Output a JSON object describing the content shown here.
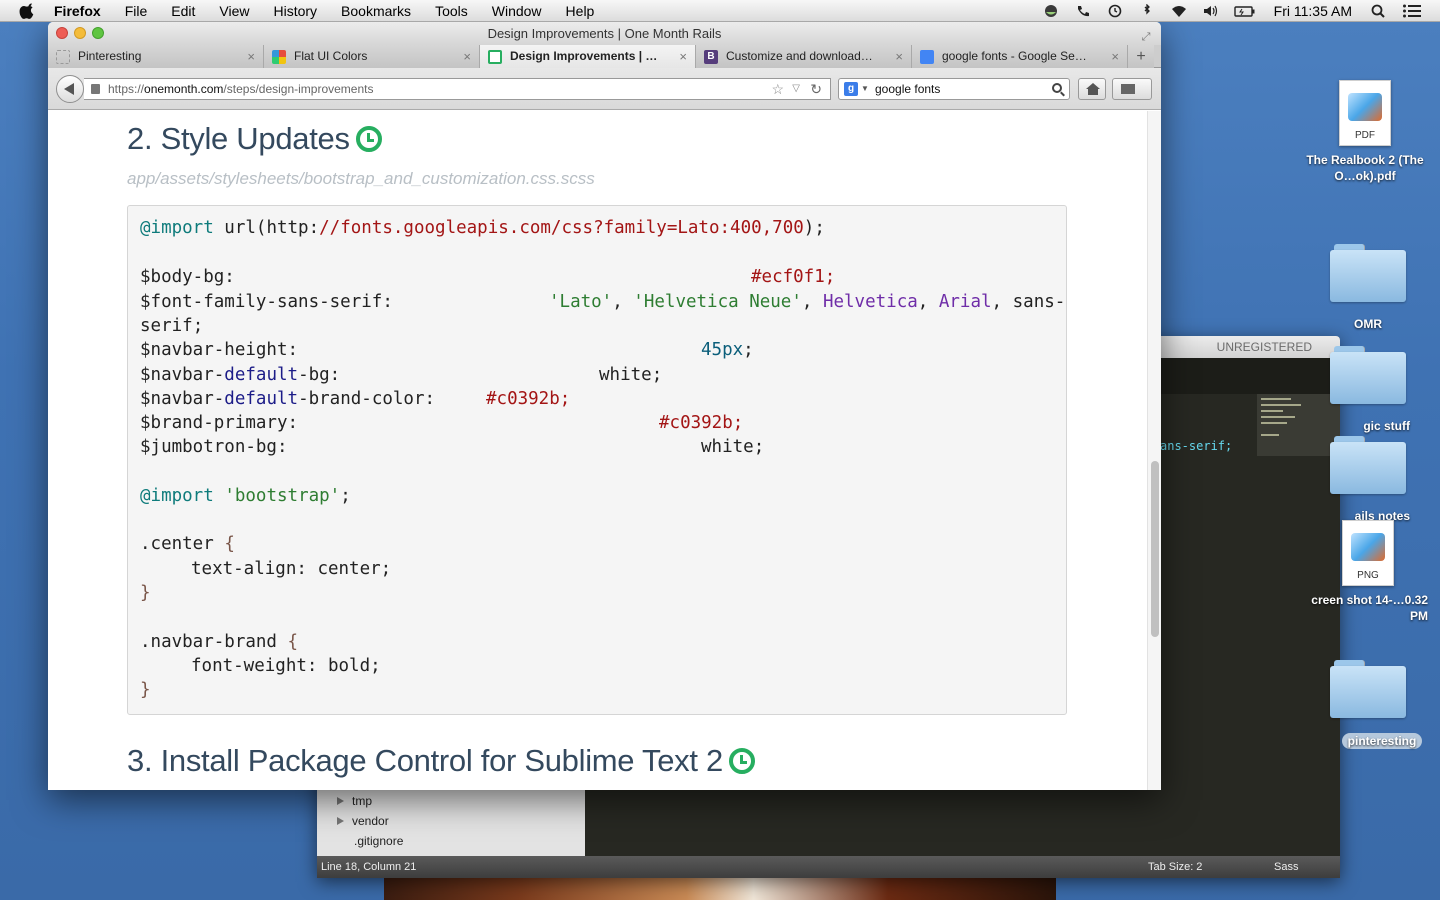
{
  "menubar": {
    "items": [
      "Firefox",
      "File",
      "Edit",
      "View",
      "History",
      "Bookmarks",
      "Tools",
      "Window",
      "Help"
    ],
    "clock": "Fri 11:35 AM"
  },
  "firefox": {
    "window_title": "Design Improvements | One Month Rails",
    "tabs": [
      {
        "title": "Pinteresting",
        "favicon_color": "#ffffff"
      },
      {
        "title": "Flat UI Colors",
        "favicon_color": "#e67e22"
      },
      {
        "title": "Design Improvements | O…",
        "favicon_color": "#27ae60"
      },
      {
        "title": "Customize and download…",
        "favicon_color": "#563d7c",
        "favicon_letter": "B"
      },
      {
        "title": "google fonts - Google Se…",
        "favicon_color": "#4285f4"
      }
    ],
    "url": {
      "scheme": "https://",
      "host": "onemonth.com",
      "path": "/steps/design-improvements"
    },
    "search_value": "google fonts"
  },
  "page": {
    "heading_style": "2. Style Updates",
    "file_path": "app/assets/stylesheets/bootstrap_and_customization.css.scss",
    "heading_next": "3. Install Package Control for Sublime Text 2",
    "code": {
      "line1": {
        "kw": "@import",
        "a": " url(",
        "b": "http:",
        "c": "//fonts.googleapis.com/css?family=Lato:400,700",
        "d": ");"
      },
      "line2": {
        "name": "$body-bg",
        "value": "#ecf0f1"
      },
      "line3": {
        "name": "$font-family-sans-serif",
        "v1": "'Lato'",
        "v2": "'Helvetica Neue'",
        "v3": "Helvetica",
        "v4": "Arial",
        "v5": "sans-",
        "wrap": "serif"
      },
      "line4": {
        "name": "$navbar-height",
        "value": "45px"
      },
      "line5": {
        "pre": "$navbar-",
        "mid": "default",
        "post": "-bg",
        "value": "white"
      },
      "line6": {
        "pre": "$navbar-",
        "mid": "default",
        "post": "-brand-color",
        "value": "#c0392b"
      },
      "line7": {
        "name": "$brand-primary",
        "value": "#c0392b"
      },
      "line8": {
        "name": "$jumbotron-bg",
        "value": "white"
      },
      "line9": {
        "kw": "@import",
        "str": "'bootstrap'"
      },
      "line10": {
        "sel": ".center",
        "prop": "text-align",
        "val": "center"
      },
      "line11": {
        "sel": ".navbar-brand",
        "prop": "font-weight",
        "val": "bold"
      }
    }
  },
  "sublime": {
    "title": "UNREGISTERED",
    "sidebar_items": [
      "tmp",
      "vendor",
      ".gitignore"
    ],
    "code_peek": "ans-serif;",
    "status_position": "Line 18, Column 21",
    "status_tab": "Tab Size: 2",
    "status_syntax": "Sass"
  },
  "desktop_icons": [
    {
      "label": "The Realbook 2 (The O…ok).pdf",
      "kind": "PDF"
    },
    {
      "label": "OMR"
    },
    {
      "label": "gic stuff"
    },
    {
      "label": "ails notes"
    },
    {
      "label": "creen shot 14-…0.32 PM",
      "kind": "PNG"
    },
    {
      "label": "pinteresting"
    }
  ]
}
